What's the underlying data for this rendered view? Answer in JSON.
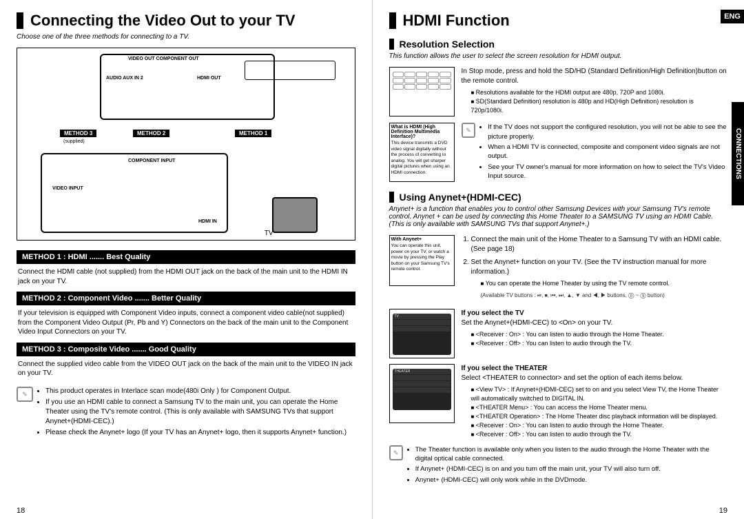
{
  "left": {
    "title": "Connecting the Video Out to your TV",
    "intro": "Choose one of the three methods for connecting to a TV.",
    "diagram": {
      "ports_top": "VIDEO OUT  COMPONENT OUT",
      "ports_side": "AUDIO  AUX IN 2",
      "hdmi": "HDMI OUT",
      "m1": "METHOD 1",
      "m2": "METHOD 2",
      "m3": "METHOD 3",
      "supplied": "(supplied)",
      "comp_in": "COMPONENT INPUT",
      "vin": "VIDEO INPUT",
      "hdmi_in": "HDMI IN",
      "tv": "TV"
    },
    "methods": [
      {
        "head": "METHOD 1 : HDMI ....... Best Quality",
        "body": "Connect the HDMI cable (not supplied) from the HDMI OUT jack on the back of the main unit to the HDMI IN jack on your TV."
      },
      {
        "head": "METHOD 2 : Component Video ....... Better Quality",
        "body": "If your television is equipped with Component Video inputs, connect a component video cable(not supplied) from the Component Video Output (Pr, Pb and Y) Connectors on the back of the main unit to the Component Video Input Connectors on your TV."
      },
      {
        "head": "METHOD 3 : Composite Video ....... Good Quality",
        "body": "Connect the supplied video cable from the VIDEO OUT jack on the back of the main unit to the VIDEO IN jack on your TV."
      }
    ],
    "notes": [
      "This product operates in Interlace scan mode(480i Only ) for Component Output.",
      "If you use an HDMI cable to connect a Samsung TV to the main unit, you can operate the Home Theater using the TV's remote control. (This is only available with SAMSUNG TVs that support Anynet+(HDMI-CEC).)",
      "Please check the Anynet+ logo (If your TV has an Anynet+ logo, then it supports Anynet+ function.)"
    ],
    "page": "18"
  },
  "right": {
    "title": "HDMI Function",
    "lang": "ENG",
    "tab": "CONNECTIONS",
    "res": {
      "head": "Resolution Selection",
      "intro": "This function allows the user to select the screen resolution for HDMI output.",
      "step": "In Stop mode, press and hold the SD/HD (Standard Definition/High Definition)button on the remote control.",
      "bullets": [
        "Resolutions available for the HDMI output are 480p, 720P and 1080i.",
        "SD(Standard Definition) resolution is 480p and HD(High Definition) resolution is 720p/1080i."
      ],
      "note_bullets": [
        "If the TV does not support the configured resolution, you will not be able to see the picture properly.",
        "When a HDMI TV is connected, composite and component video signals are not output.",
        "See your TV owner's manual for more information on how to select the TV's Video Input source."
      ],
      "what_head": "What is HDMI (High Definition Multimedia Interface)?",
      "what_body": "This device transmits a DVD video signal digitally without the process of converting to analog. You will get sharper digital pictures when using an HDMI connection."
    },
    "any": {
      "head": "Using Anynet+(HDMI-CEC)",
      "intro": "Anynet+ is a function that enables you to control other Samsung Devices with your Samsung TV's remote control. Anynet + can be used by connecting this Home Theater to a SAMSUNG TV using an HDMI Cable. (This is only available with SAMSUNG TVs that support Anynet+.)",
      "with_head": "With Anynet+",
      "with_body": "You can operate this unit, power on your TV, or watch a movie by pressing the Play button on your Samsung TV's remote control.",
      "steps": [
        "Connect the main unit of the Home Theater to a Samsung TV with an HDMI cable. (See page 18)",
        "Set the Anynet+ function on your TV.\n(See the TV instruction manual for more information.)"
      ],
      "step2_bullet": "You can operate the Home Theater by using the TV remote control.",
      "step2_sub": "(Available TV buttons : ⏯, ⏹, ⏮, ⏭, ▲, ▼ and ◀, ▶ buttons, ⓪ ~ ⑨ button)",
      "tv_head": "If you select the TV",
      "tv_set": "Set the Anynet+(HDMI-CEC) to <On> on your TV.",
      "tv_list": [
        "<Receiver : On> : You can listen to audio through the Home Theater.",
        "<Receiver : Off> : You can listen to audio through the TV."
      ],
      "th_head": "If you select the THEATER",
      "th_set": "Select <THEATER to connector> and set the option of each items below.",
      "th_list": [
        "<View TV> : If Anynet+(HDMI-CEC) set to on and you select View TV, the Home Theater will automatically switched to DIGITAL IN.",
        "<THEATER Menu> : You can access the Home Theater menu.",
        "<THEATER Operation> : The Home Theater disc playback information will be displayed.",
        "<Receiver : On> : You can listen to audio through the Home Theater.",
        "<Receiver : Off> : You can listen to audio through the TV."
      ],
      "final_notes": [
        "The Theater function is available only when you listen to the audio through the Home Theater with the digital optical cable connected.",
        "If Anynet+ (HDMI-CEC) is on and you turn off the main unit, your TV will also turn off.",
        "Anynet+ (HDMI-CEC) will only work while in the DVDmode."
      ]
    },
    "page": "19"
  }
}
